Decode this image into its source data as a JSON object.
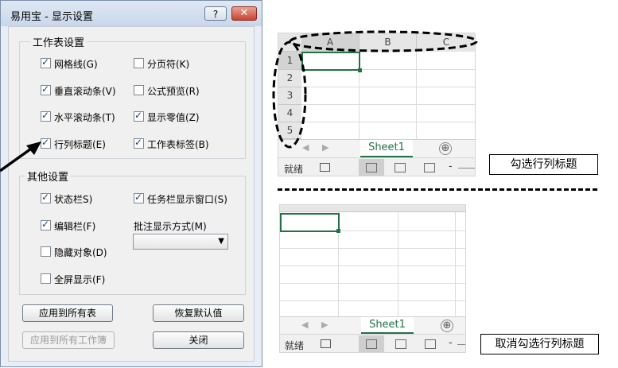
{
  "dialog": {
    "title": "易用宝 - 显示设置",
    "help_label": "?",
    "close_label": "✕",
    "group_sheet": {
      "title": "工作表设置",
      "items": [
        {
          "label": "网格线(G)",
          "checked": true
        },
        {
          "label": "分页符(K)",
          "checked": false
        },
        {
          "label": "垂直滚动条(V)",
          "checked": true
        },
        {
          "label": "公式预览(R)",
          "checked": false
        },
        {
          "label": "水平滚动条(T)",
          "checked": true
        },
        {
          "label": "显示零值(Z)",
          "checked": true
        },
        {
          "label": "行列标题(E)",
          "checked": true
        },
        {
          "label": "工作表标签(B)",
          "checked": true
        }
      ]
    },
    "group_other": {
      "title": "其他设置",
      "items": [
        {
          "label": "状态栏S)",
          "checked": true
        },
        {
          "label": "任务栏显示窗口(S)",
          "checked": true
        },
        {
          "label": "编辑栏(F)",
          "checked": true
        },
        {
          "label": "隐藏对象(D)",
          "checked": false
        },
        {
          "label": "全屏显示(F)",
          "checked": false
        }
      ],
      "comment_label": "批注显示方式(M)",
      "comment_value": ""
    },
    "buttons": {
      "apply_all_sheets": "应用到所有表",
      "restore_default": "恢复默认值",
      "apply_all_workbooks": "应用到所有工作簿",
      "close": "关闭"
    }
  },
  "excel_top": {
    "columns": [
      "A",
      "B",
      "C"
    ],
    "rows": [
      "1",
      "2",
      "3",
      "4",
      "5"
    ],
    "sheet_tab": "Sheet1",
    "add_sheet": "⊕",
    "status_ready": "就绪",
    "caption": "勾选行列标题"
  },
  "excel_bottom": {
    "sheet_tab": "Sheet1",
    "add_sheet": "⊕",
    "status_ready": "就绪",
    "caption": "取消勾选行列标题"
  },
  "colors": {
    "excel_green": "#217346",
    "dialog_bg": "#e9eef6"
  }
}
